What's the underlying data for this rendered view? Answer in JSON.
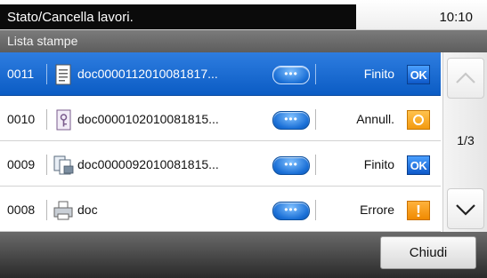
{
  "header": {
    "title": "Stato/Cancella lavori.",
    "time": "10:10"
  },
  "subheader": {
    "title": "Lista stampe"
  },
  "jobs": [
    {
      "number": "0011",
      "name": "doc0000112010081817...",
      "status": "Finito",
      "type_icon": "document-icon",
      "status_icon": "ok-icon",
      "ok_text": "OK",
      "selected": true
    },
    {
      "number": "0010",
      "name": "doc0000102010081815...",
      "status": "Annull.",
      "type_icon": "private-document-icon",
      "status_icon": "cancelled-icon",
      "selected": false
    },
    {
      "number": "0009",
      "name": "doc0000092010081815...",
      "status": "Finito",
      "type_icon": "copy-document-icon",
      "status_icon": "ok-icon",
      "ok_text": "OK",
      "selected": false
    },
    {
      "number": "0008",
      "name": "doc",
      "status": "Errore",
      "type_icon": "printer-document-icon",
      "status_icon": "error-icon",
      "error_text": "!",
      "selected": false
    }
  ],
  "detail_button": {
    "dots": "•••"
  },
  "pagination": {
    "label": "1/3"
  },
  "footer": {
    "close_label": "Chiudi"
  },
  "colors": {
    "selected_row": "#1a6ad2",
    "ok_badge": "#1a6fe0",
    "warning_badge": "#f39a10"
  }
}
